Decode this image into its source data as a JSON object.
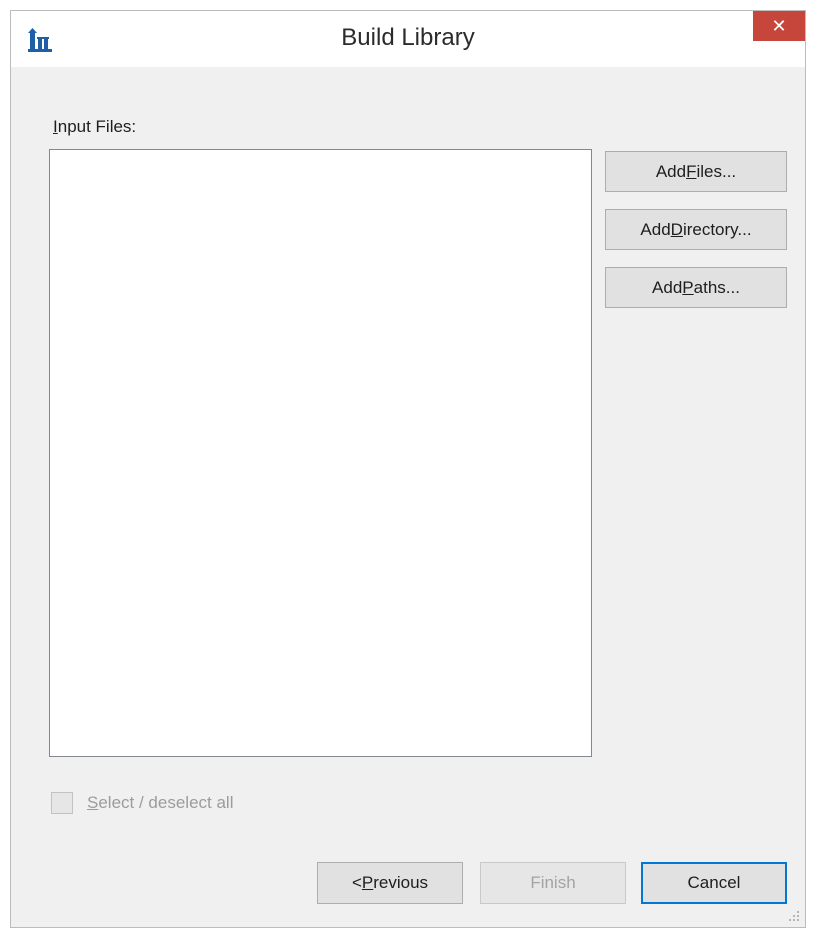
{
  "window": {
    "title": "Build Library",
    "close_glyph": "✕"
  },
  "input_files": {
    "label_accesskey": "I",
    "label_rest": "nput Files:",
    "items": []
  },
  "buttons": {
    "add_files": {
      "pre": "Add ",
      "key": "F",
      "post": "iles..."
    },
    "add_directory": {
      "pre": "Add ",
      "key": "D",
      "post": "irectory..."
    },
    "add_paths": {
      "pre": "Add ",
      "key": "P",
      "post": "aths..."
    },
    "previous": {
      "pre": "< ",
      "key": "P",
      "post": "revious"
    },
    "finish": {
      "label": "Finish"
    },
    "cancel": {
      "label": "Cancel"
    }
  },
  "select_all": {
    "key": "S",
    "rest": "elect / deselect all",
    "checked": false,
    "enabled": false
  },
  "icons": {
    "app": "library-tower-icon",
    "close": "close-icon",
    "grip": "resize-grip-icon"
  },
  "colors": {
    "close_bg": "#c7463b",
    "app_icon": "#1f5fa8",
    "focus_border": "#0078d7"
  }
}
